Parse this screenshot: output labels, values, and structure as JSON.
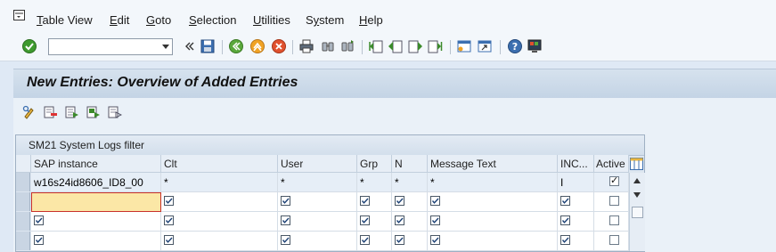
{
  "menubar": {
    "items": [
      {
        "label": "Table View",
        "underline": "T"
      },
      {
        "label": "Edit",
        "underline": "E"
      },
      {
        "label": "Goto",
        "underline": "G"
      },
      {
        "label": "Selection",
        "underline": "S"
      },
      {
        "label": "Utilities",
        "underline": "U"
      },
      {
        "label": "System",
        "underline": "y"
      },
      {
        "label": "Help",
        "underline": "H"
      }
    ]
  },
  "toolbar": {
    "command_field_value": "",
    "icons": [
      "enter-icon",
      "save-icon",
      "back-icon",
      "exit-icon",
      "cancel-icon",
      "print-icon",
      "find-icon",
      "find-next-icon",
      "first-page-icon",
      "previous-page-icon",
      "next-page-icon",
      "last-page-icon",
      "create-session-icon",
      "shortcut-icon",
      "help-icon",
      "customize-layout-icon"
    ]
  },
  "title": "New Entries: Overview of Added Entries",
  "app_toolbar": {
    "icons": [
      "change-display-icon",
      "delete-icon",
      "select-all-icon",
      "select-block-icon",
      "deselect-all-icon"
    ]
  },
  "table": {
    "title": "SM21 System Logs filter",
    "columns": [
      "SAP instance",
      "Clt",
      "User",
      "Grp",
      "N",
      "Message Text",
      "INC...",
      "Active"
    ],
    "rows": [
      {
        "sap_instance": "w16s24id8606_ID8_00",
        "clt": "*",
        "user": "*",
        "grp": "*",
        "n": "*",
        "message_text": "*",
        "inc": "I",
        "active": true,
        "checked_fields": false
      },
      {
        "sap_instance": "",
        "clt": "",
        "user": "",
        "grp": "",
        "n": "",
        "message_text": "",
        "inc": "",
        "active": false,
        "checked_fields": true
      },
      {
        "sap_instance": "",
        "clt": "",
        "user": "",
        "grp": "",
        "n": "",
        "message_text": "",
        "inc": "",
        "active": false,
        "checked_fields": true
      },
      {
        "sap_instance": "",
        "clt": "",
        "user": "",
        "grp": "",
        "n": "",
        "message_text": "",
        "inc": "",
        "active": false,
        "checked_fields": true
      }
    ]
  }
}
